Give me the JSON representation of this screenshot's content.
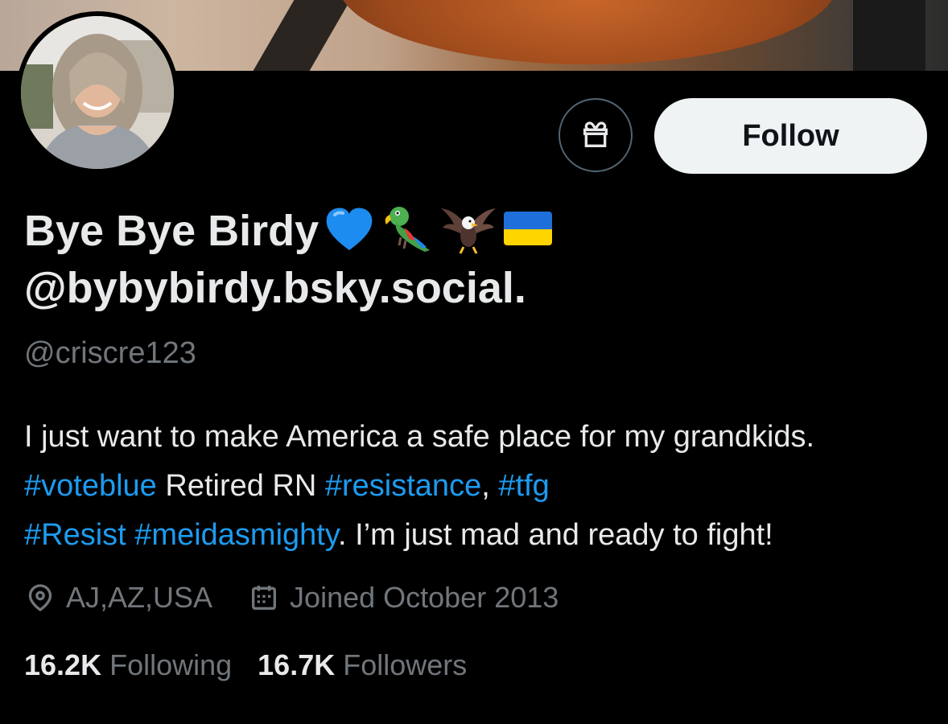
{
  "profile": {
    "display_name": "Bye Bye Birdy",
    "display_name_line2": "@bybybirdy.bsky.social.",
    "name_emojis": [
      "blue-heart-emoji",
      "parrot-emoji",
      "eagle-emoji",
      "ukraine-flag-emoji"
    ],
    "handle": "@criscre123",
    "location": "AJ,AZ,USA",
    "joined": "Joined October 2013"
  },
  "actions": {
    "follow_label": "Follow",
    "gift_icon": "gift-icon"
  },
  "bio": {
    "t1": "I just want to make America a safe place for my grandkids. ",
    "tag1": "#voteblue",
    "t2": " Retired RN ",
    "tag2": "#resistance",
    "t3": ", ",
    "tag3": "#tfg",
    "t4": " ",
    "tag4": "#Resist",
    "t5": " ",
    "tag5": "#meidasmighty",
    "t6": ". I’m just mad and ready to fight!"
  },
  "stats": {
    "following_count": "16.2K",
    "following_label": "Following",
    "followers_count": "16.7K",
    "followers_label": "Followers"
  },
  "colors": {
    "background": "#000000",
    "text_primary": "#e7e9ea",
    "text_secondary": "#71767b",
    "link": "#1d9bf0",
    "follow_button_bg": "#eff3f4"
  }
}
